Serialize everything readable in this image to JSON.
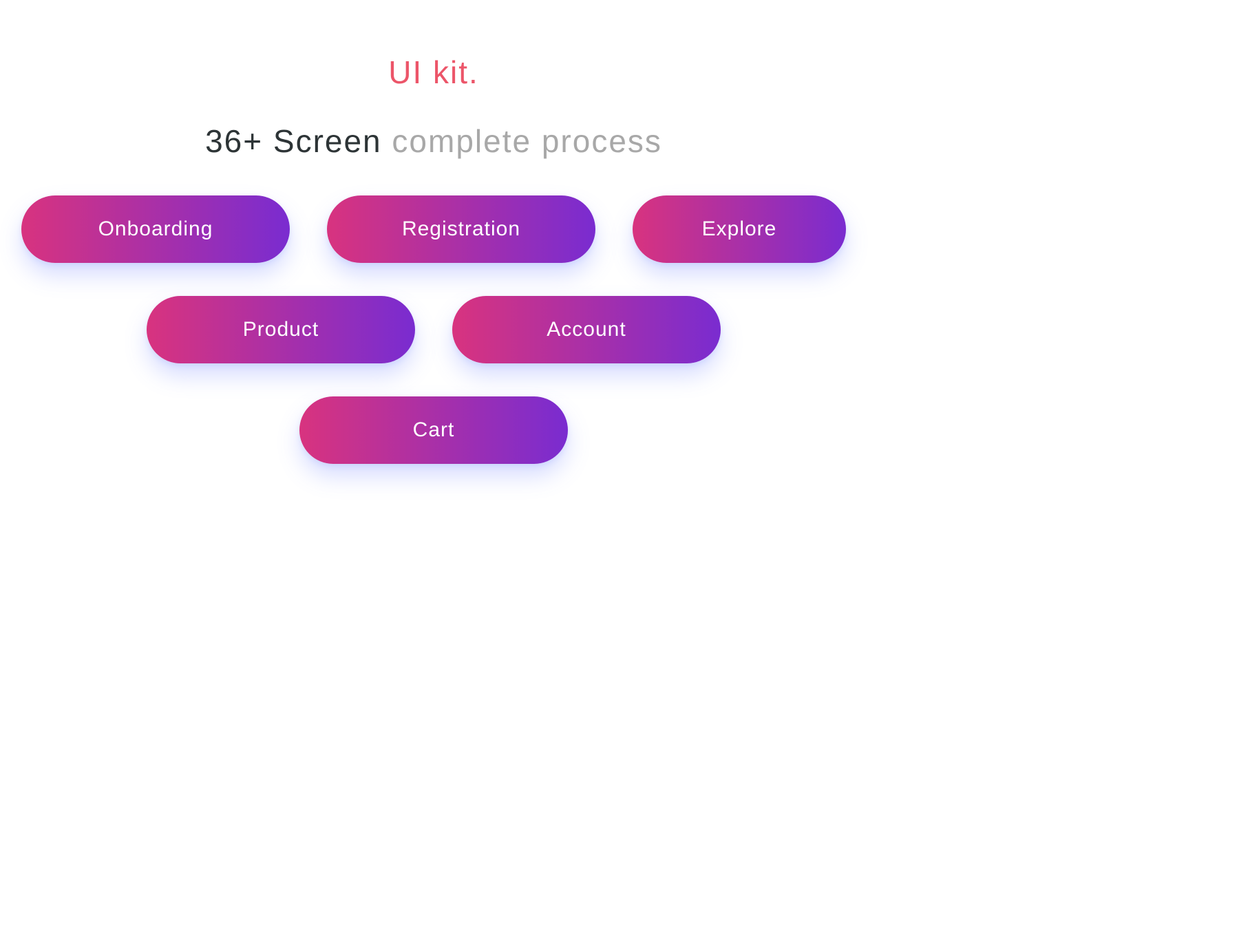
{
  "header": {
    "title": "UI kit.",
    "subtitle_bold": "36+ Screen ",
    "subtitle_light": "complete process"
  },
  "buttons": {
    "row1": [
      {
        "id": "onboarding",
        "label": "Onboarding"
      },
      {
        "id": "registration",
        "label": "Registration"
      },
      {
        "id": "explore",
        "label": "Explore"
      }
    ],
    "row2": [
      {
        "id": "product",
        "label": "Product"
      },
      {
        "id": "account",
        "label": "Account"
      }
    ],
    "row3": [
      {
        "id": "cart",
        "label": "Cart"
      }
    ]
  },
  "colors": {
    "accent": "#ec5569",
    "gradient_start": "#d8337f",
    "gradient_end": "#7a2cd0",
    "text_dark": "#2d3436",
    "text_muted": "#a8a8a8"
  }
}
